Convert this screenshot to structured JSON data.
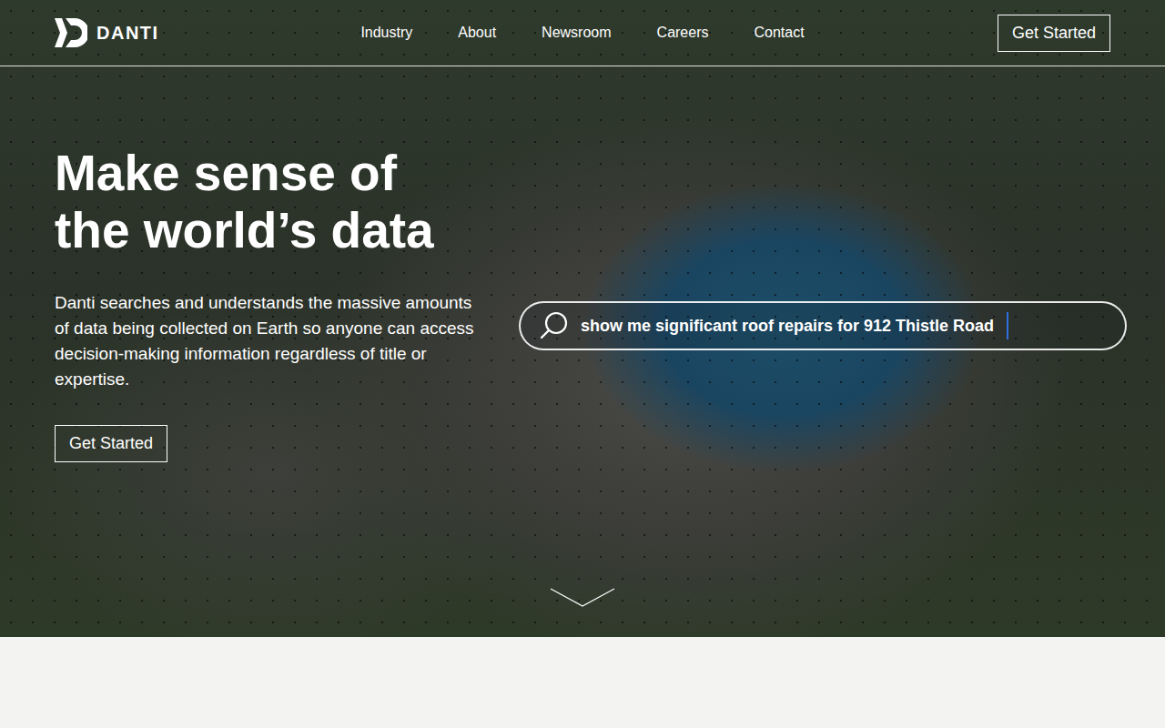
{
  "header": {
    "logo": "DANTI",
    "nav": [
      "Industry",
      "About",
      "Newsroom",
      "Careers",
      "Contact"
    ],
    "cta": "Get Started"
  },
  "hero": {
    "title_lines": [
      "Make sense of",
      "the world’s data"
    ],
    "description": "Danti searches and understands the massive amounts of data being collected on Earth so anyone can access decision-making information regardless of title or expertise.",
    "cta": "Get Started",
    "search": {
      "query": "show me significant roof repairs for 912 Thistle Road"
    }
  }
}
